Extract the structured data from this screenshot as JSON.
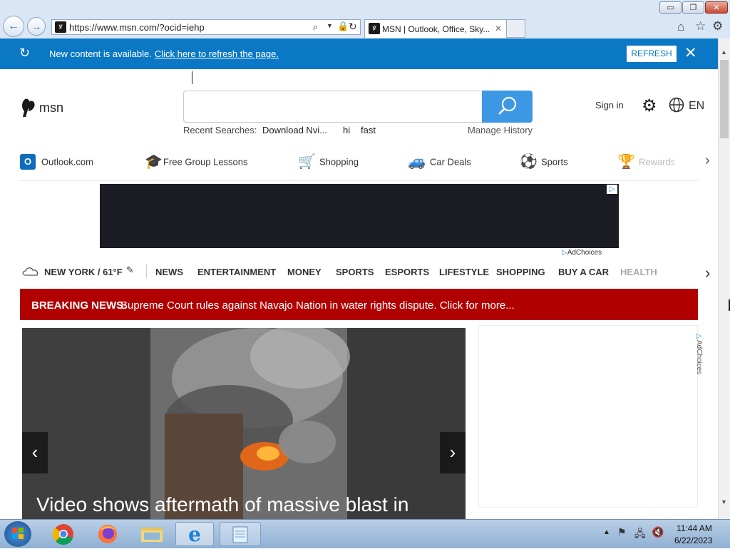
{
  "window": {
    "minimize_label": "▭",
    "restore_label": "❐",
    "close_label": "✕"
  },
  "browser": {
    "back_icon": "arrow-left-icon",
    "forward_icon": "arrow-right-icon",
    "address_url": "https://www.msn.com/?ocid=iehp",
    "tab_title": "MSN | Outlook, Office, Sky...",
    "tab_close": "✕"
  },
  "notification": {
    "text": "New content is available.",
    "link_text": "Click here to refresh the page.",
    "refresh_label": "REFRESH",
    "close_label": "✕"
  },
  "header": {
    "logo_text": "msn",
    "search_placeholder": "",
    "recent_label": "Recent Searches:",
    "recent_items": [
      "Download Nvi...",
      "hi",
      "fast"
    ],
    "manage_history": "Manage History",
    "signin": "Sign in",
    "language": "EN"
  },
  "shortcuts": [
    {
      "label": "Outlook.com",
      "color": "#0f6cbd"
    },
    {
      "label": "Free Group Lessons",
      "color": "#6a2fa0"
    },
    {
      "label": "Shopping",
      "color": "#1463c9"
    },
    {
      "label": "Car Deals",
      "color": "#1b86c9"
    },
    {
      "label": "Sports",
      "color": "#2b2b6a"
    },
    {
      "label": "Rewards",
      "color": "#e8a62a"
    }
  ],
  "ad": {
    "adchoices": "AdChoices"
  },
  "nav": {
    "weather": "NEW YORK / 61°F",
    "items": [
      "NEWS",
      "ENTERTAINMENT",
      "MONEY",
      "SPORTS",
      "ESPORTS",
      "LIFESTYLE",
      "SHOPPING",
      "BUY A CAR",
      "HEALTH"
    ]
  },
  "breaking": {
    "label": "BREAKING NEWS:",
    "text": "Supreme Court rules against Navajo Nation in water rights dispute. Click for more..."
  },
  "hero": {
    "headline": "Video shows aftermath of massive blast in"
  },
  "side_ad": {
    "adchoices": "AdChoices"
  },
  "taskbar": {
    "time": "11:44 AM",
    "date": "6/22/2023"
  },
  "colors": {
    "notification_bg": "#0a78c4",
    "search_button": "#3d98e3",
    "breaking_bg": "#b10000"
  }
}
